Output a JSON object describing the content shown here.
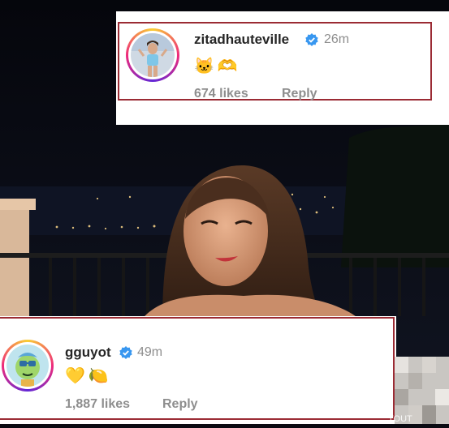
{
  "comment_top": {
    "username": "zitadhauteville",
    "time": "26m",
    "emoji": [
      "🐱",
      "🫶"
    ],
    "likes": "674 likes",
    "reply": "Reply",
    "avatar_icon": "profile-photo-icon",
    "verified_icon": "verified-badge-icon"
  },
  "comment_bottom": {
    "username": "gguyot",
    "time": "49m",
    "emoji": [
      "💛",
      "🍋"
    ],
    "likes": "1,887 likes",
    "reply": "Reply",
    "avatar_icon": "cartoon-avatar-icon",
    "verified_icon": "verified-badge-icon"
  },
  "watermark": "TOUT",
  "colors": {
    "highlight_border": "#9b2b34",
    "verified_blue": "#3897f0",
    "muted": "#8e8e8e",
    "text": "#262626"
  }
}
